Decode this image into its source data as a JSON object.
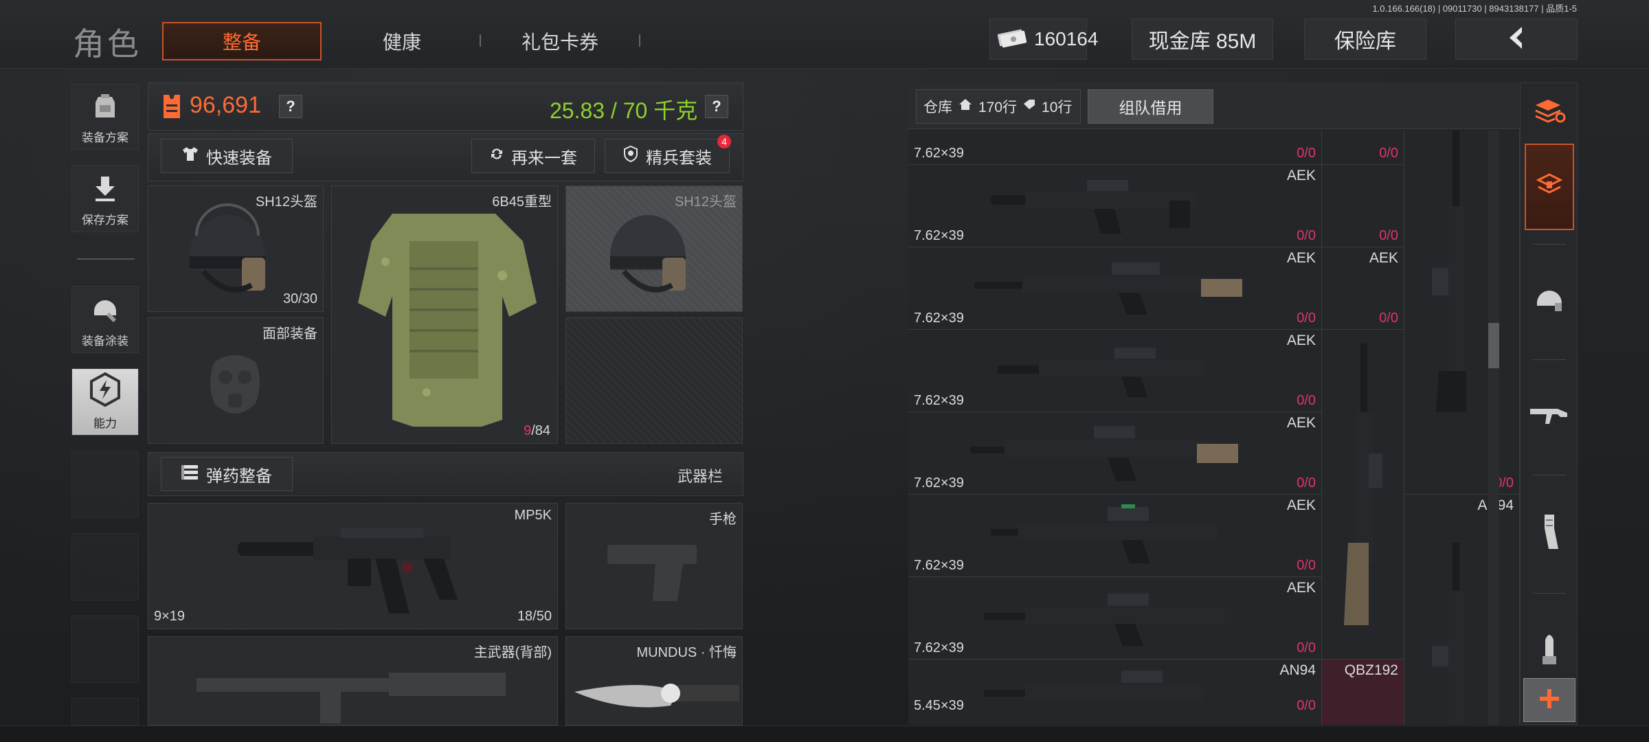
{
  "app": {
    "title": "角色",
    "version": "1.0.166.166(18) | 09011730 | 8943138177 | 品质1-5"
  },
  "tabs": [
    {
      "label": "整备",
      "active": true
    },
    {
      "label": "健康",
      "active": false
    },
    {
      "label": "礼包卡券",
      "active": false
    }
  ],
  "currency": {
    "bills": "160164",
    "cash_vault": "现金库 85M",
    "safe": "保险库"
  },
  "sidebar": [
    {
      "label": "装备方案",
      "icon": "backpack-icon"
    },
    {
      "label": "保存方案",
      "icon": "download-icon"
    },
    {
      "label": "装备涂装",
      "icon": "helmet-paint-icon"
    },
    {
      "label": "能力",
      "icon": "lightning-hex-icon",
      "active": true
    }
  ],
  "loadout": {
    "value": "96,691",
    "weight": "25.83 / 70 千克",
    "help": "?",
    "quick_equip": "快速装备",
    "again": "再来一套",
    "elite_set": "精兵套装",
    "elite_badge": "4",
    "ammo_equip": "弹药整备",
    "weapon_bar": "武器栏"
  },
  "gear": {
    "helmet": {
      "name": "SH12头盔",
      "durability": "30/30"
    },
    "armor": {
      "name": "6B45重型",
      "durability_current": "9",
      "durability_max": "/84"
    },
    "helmet_preview": {
      "name": "SH12头盔"
    },
    "face": {
      "name": "面部装备"
    }
  },
  "weapons": {
    "primary": {
      "name": "MP5K",
      "caliber": "9×19",
      "ammo": "18/50"
    },
    "pistol": {
      "name": "手枪"
    },
    "back": {
      "name": "主武器(背部)"
    },
    "melee": {
      "name": "MUNDUS · 忏悔"
    }
  },
  "storage": {
    "label": "仓库",
    "rows": "170行",
    "tag_rows": "10行",
    "team_borrow": "组队借用",
    "cells": [
      {
        "caliber": "7.62×39",
        "count": "0/0"
      },
      {
        "name": "AEK",
        "caliber": "7.62×39",
        "count": "0/0"
      },
      {
        "name": "AEK",
        "caliber": "7.62×39",
        "count": "0/0"
      },
      {
        "name": "AEK",
        "caliber": "7.62×39",
        "count": "0/0"
      },
      {
        "name": "AEK",
        "caliber": "7.62×39",
        "count": "0/0"
      },
      {
        "name": "AEK",
        "caliber": "7.62×39",
        "count": "0/0"
      },
      {
        "name": "AEK",
        "caliber": "7.62×39",
        "count": "0/0"
      },
      {
        "name": "AN94",
        "caliber": "5.45×39",
        "count": "0/0"
      }
    ],
    "side_cells": [
      {
        "count": "0/0"
      },
      {
        "name": "AEK",
        "count": "0/0"
      },
      {
        "name": "AN94",
        "count": ""
      },
      {
        "count": "0/0"
      },
      {
        "name": "QBZ192",
        "count": ""
      }
    ],
    "tall_count": "0/0"
  },
  "colors": {
    "accent": "#ff6a32",
    "weight_green": "#8fd12b",
    "count_red": "#e0356a"
  }
}
